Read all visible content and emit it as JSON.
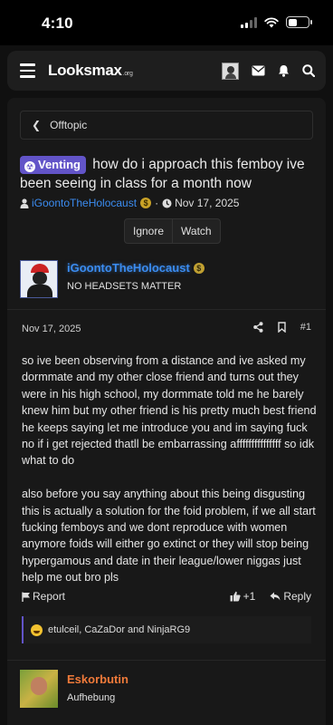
{
  "status_bar": {
    "time": "4:10",
    "signal_bars": 2,
    "battery_level": 0.3
  },
  "header": {
    "logo_main": "Looksmax",
    "logo_suffix": ".org",
    "icons": [
      "menu-icon",
      "user-avatar",
      "mail-icon",
      "bell-icon",
      "search-icon"
    ]
  },
  "breadcrumb": {
    "label": "Offtopic"
  },
  "thread": {
    "badge": "Venting",
    "title": "how do i approach this femboy ive been seeing in class for a month now",
    "author": "iGoontoTheHolocaust",
    "date": "Nov 17, 2025",
    "ignore_label": "Ignore",
    "watch_label": "Watch"
  },
  "post": {
    "author": "iGoontoTheHolocaust",
    "user_title": "NO HEADSETS MATTER",
    "date": "Nov 17, 2025",
    "number": "#1",
    "body_1": "so ive been observing from a distance and ive asked my dormmate and my other close friend and turns out they were in his high school, my dormmate told me he barely knew him but my other friend is his pretty much best friend he keeps saying let me introduce you and im saying fuck no if i get rejected thatll be embarrassing afffffffffffffff so idk what to do",
    "body_2": "also before you say anything about this being disgusting this is actually a solution for the foid problem, if we all start fucking femboys and we dont reproduce with women anymore foids will either go extinct or they will stop being hypergamous and date in their league/lower niggas just help me out bro pls",
    "report_label": "Report",
    "like_count": "+1",
    "reply_label": "Reply",
    "reactions_text": "etulceil, CaZaDor and NinjaRG9"
  },
  "next_post": {
    "author": "Eskorbutin",
    "user_title": "Aufhebung"
  },
  "colors": {
    "accent": "#6254c8",
    "username_blue": "#3b8cf0",
    "username_orange": "#f07a3a"
  }
}
